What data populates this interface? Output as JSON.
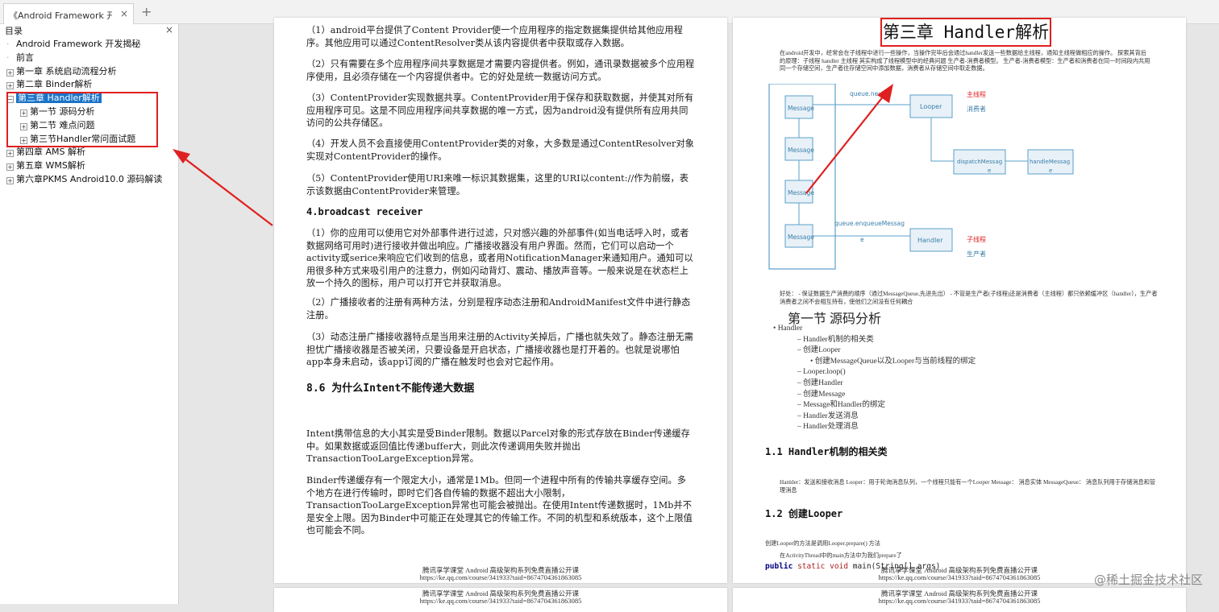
{
  "tab": {
    "title": "《Android Framework 开发揭秘",
    "close": "×",
    "add": "+"
  },
  "sidebar": {
    "heading": "目录",
    "close": "×",
    "items": [
      {
        "label": "Android Framework 开发揭秘",
        "level": 1,
        "kind": "leaf"
      },
      {
        "label": "前言",
        "level": 1,
        "kind": "leaf"
      },
      {
        "label": "第一章  系统启动流程分析",
        "level": 1,
        "kind": "collapsed"
      },
      {
        "label": "第二章 Binder解析",
        "level": 1,
        "kind": "collapsed"
      },
      {
        "label": "第三章 Handler解析",
        "level": 1,
        "kind": "expanded",
        "selected": true
      },
      {
        "label": "第一节 源码分析",
        "level": 2,
        "kind": "collapsed"
      },
      {
        "label": "第二节 难点问题",
        "level": 2,
        "kind": "collapsed"
      },
      {
        "label": "第三节Handler常问面试题",
        "level": 2,
        "kind": "collapsed"
      },
      {
        "label": "第四章 AMS 解析",
        "level": 1,
        "kind": "collapsed"
      },
      {
        "label": "第五章 WMS解析",
        "level": 1,
        "kind": "collapsed"
      },
      {
        "label": "第六章PKMS Android10.0 源码解读",
        "level": 1,
        "kind": "collapsed"
      }
    ]
  },
  "page1": {
    "p1": "（1）android平台提供了Content Provider使一个应用程序的指定数据集提供给其他应用程序。其他应用可以通过ContentResolver类从该内容提供者中获取或存入数据。",
    "p2": "（2）只有需要在多个应用程序间共享数据是才需要内容提供者。例如，通讯录数据被多个应用程序使用，且必须存储在一个内容提供者中。它的好处是统一数据访问方式。",
    "p3": "（3）ContentProvider实现数据共享。ContentProvider用于保存和获取数据，并使其对所有应用程序可见。这是不同应用程序间共享数据的唯一方式，因为android没有提供所有应用共同访问的公共存储区。",
    "p4": "（4）开发人员不会直接使用ContentProvider类的对象，大多数是通过ContentResolver对象实现对ContentProvider的操作。",
    "p5": "（5）ContentProvider使用URI来唯一标识其数据集，这里的URI以content://作为前缀，表示该数据由ContentProvider来管理。",
    "h_broadcast": "4.broadcast receiver",
    "b1": "（1）你的应用可以使用它对外部事件进行过滤，只对感兴趣的外部事件(如当电话呼入时，或者数据网络可用时)进行接收并做出响应。广播接收器没有用户界面。然而，它们可以启动一个activity或serice来响应它们收到的信息，或者用NotificationManager来通知用户。通知可以用很多种方式来吸引用户的注意力，例如闪动背灯、震动、播放声音等。一般来说是在状态栏上放一个持久的图标，用户可以打开它并获取消息。",
    "b2": "（2）广播接收者的注册有两种方法，分别是程序动态注册和AndroidManifest文件中进行静态注册。",
    "b3": "（3）动态注册广播接收器特点是当用来注册的Activity关掉后，广播也就失效了。静态注册无需担忧广播接收器是否被关闭，只要设备是开启状态，广播接收器也是打开着的。也就是说哪怕app本身未启动，该app订阅的广播在触发时也会对它起作用。",
    "h_86": "8.6 为什么Intent不能传递大数据",
    "i1": "Intent携带信息的大小其实是受Binder限制。数据以Parcel对象的形式存放在Binder传递缓存中。如果数据或返回值比传递buffer大，则此次传递调用失败并抛出TransactionTooLargeException异常。",
    "i2": "Binder传递缓存有一个限定大小，通常是1Mb。但同一个进程中所有的传输共享缓存空间。多个地方在进行传输时，即时它们各自传输的数据不超出大小限制，TransactionTooLargeException异常也可能会被抛出。在使用Intent传递数据时，1Mb并不是安全上限。因为Binder中可能正在处理其它的传输工作。不同的机型和系统版本，这个上限值也可能会不同。"
  },
  "footer": {
    "line1": "腾讯享学课堂 Android 高级架构系列免费直播公开课",
    "line2": "https://ke.qq.com/course/341933?taid=8674704361863085"
  },
  "page2": {
    "chapter_title": "第三章 Handler解析",
    "intro": "在android开发中，经常会在子线程中进行一些操作，当操作完毕后会通过handler发送一些数据给主线程，通知主线程做相应的操作。  探索其背后的原理：子线程 handler 主线程 其实构成了线程模型中的经典问题 生产者-消费者模型。 生产者-消费者模型：生产者和消费者在同一时间段内共用同一个存储空间，生产者往存储空间中添加数据，消费者从存储空间中取走数据。",
    "diagram": {
      "queue_next": "queue.next",
      "looper": "Looper",
      "main_thread": "主线程",
      "consumer": "消费者",
      "message": "Message",
      "dispatch": "dispatchMessag",
      "dispatch_e": "e",
      "handle": "handleMessag",
      "handle_e": "e",
      "enqueue": "queue.enqueueMessag",
      "enqueue_e": "e",
      "handler": "Handler",
      "child_thread": "子线程",
      "producer": "生产者"
    },
    "benefit": "好处： - 保证数据生产消费的顺序（通过MessageQueue,先进先出） - 不管是生产者(子线程)还是消费者（主线程）都只依赖缓冲区（handler），生产者消费者之间不会相互持有，使他们之间没有任何耦合",
    "section_title": "第一节 源码分析",
    "outline": [
      "•    Handler",
      "–    Handler机制的相关类",
      "–    创建Looper",
      "•    创建MessageQueue以及Looper与当前线程的绑定",
      "–    Looper.loop()",
      "–    创建Handler",
      "–    创建Message",
      "–    Message和Handler的绑定",
      "–    Handler发送消息",
      "–    Handler处理消息"
    ],
    "h11": "1.1 Handler机制的相关类",
    "h11_text": "Hanlder：发送和接收消息 Looper：用于轮询消息队列，一个线程只能有一个Looper Message： 消息实体 MessageQueue： 消息队列用于存储消息和管理消息",
    "h12": "1.2 创建Looper",
    "h12_text1": "创建Looper的方法是调用Looper.prepare() 方法",
    "h12_text2": "在ActivityThread中的main方法中为我们prepare了",
    "code_kw1": "public",
    "code_kw2": "static void",
    "code_rest": "main(String[] args)"
  },
  "watermark": "@稀土掘金技术社区"
}
